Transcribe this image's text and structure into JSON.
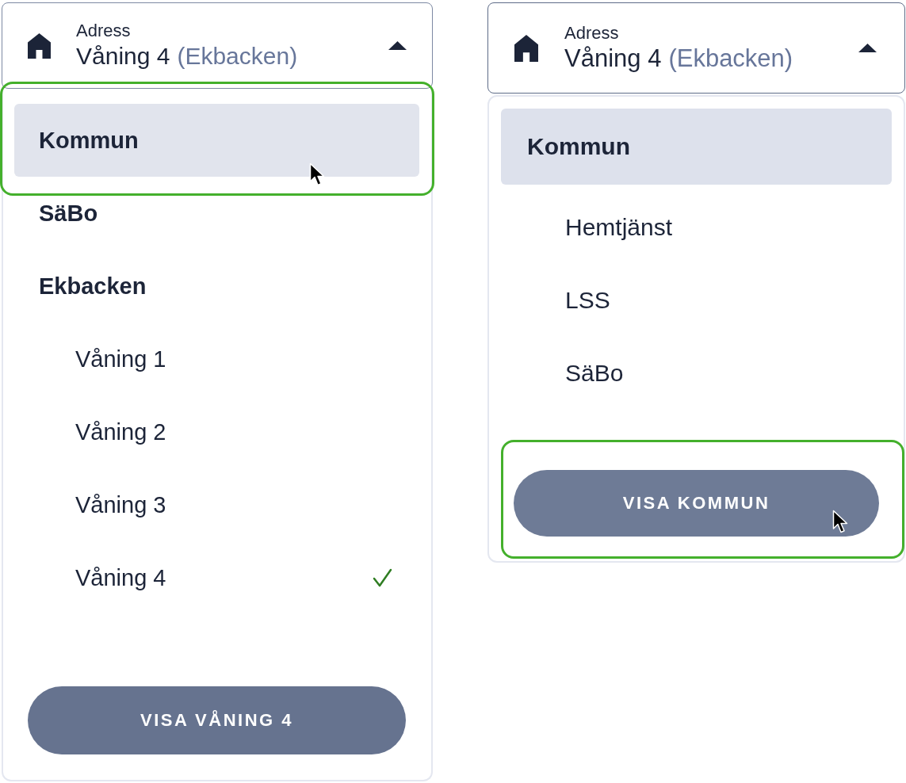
{
  "panels": [
    {
      "field": {
        "label": "Adress",
        "value": "Våning 4",
        "context": "(Ekbacken)",
        "expanded": true
      },
      "items": [
        {
          "label": "Kommun",
          "highlighted": true,
          "hovered": true,
          "annotated": true
        },
        {
          "label": "SäBo",
          "highlighted": false,
          "hovered": false,
          "annotated": false
        },
        {
          "label": "Ekbacken",
          "highlighted": false,
          "hovered": false,
          "annotated": false,
          "children": [
            {
              "label": "Våning 1",
              "checked": false
            },
            {
              "label": "Våning 2",
              "checked": false
            },
            {
              "label": "Våning 3",
              "checked": false
            },
            {
              "label": "Våning 4",
              "checked": true
            }
          ]
        }
      ],
      "button": {
        "label": "VISA VÅNING 4",
        "hovered": false,
        "annotated": false
      }
    },
    {
      "field": {
        "label": "Adress",
        "value": "Våning 4",
        "context": "(Ekbacken)",
        "expanded": true
      },
      "items": [
        {
          "label": "Kommun",
          "highlighted": true,
          "hovered": false,
          "annotated": false,
          "children": [
            {
              "label": "Hemtjänst",
              "checked": false
            },
            {
              "label": "LSS",
              "checked": false
            },
            {
              "label": "SäBo",
              "checked": false
            }
          ]
        }
      ],
      "button": {
        "label": "VISA KOMMUN",
        "hovered": true,
        "annotated": true
      }
    }
  ]
}
